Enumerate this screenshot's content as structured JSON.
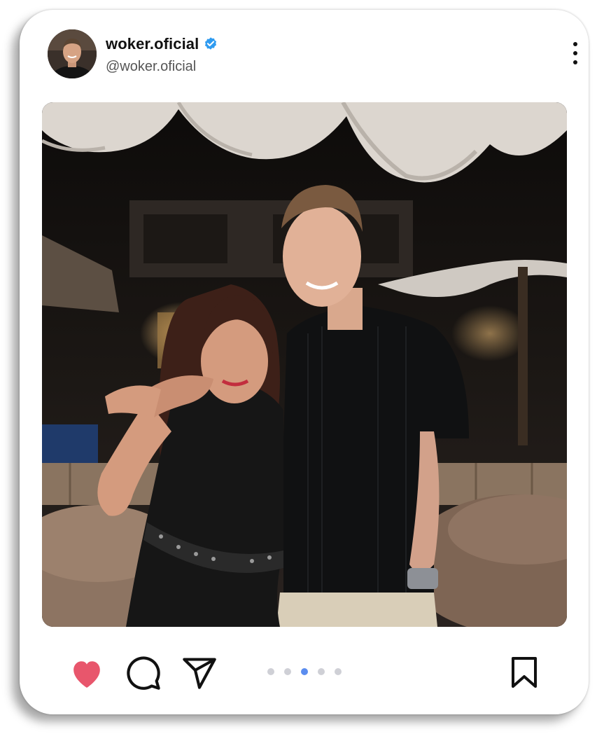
{
  "post": {
    "username": "woker.oficial",
    "handle": "@woker.oficial",
    "verified": true,
    "liked": true,
    "carousel": {
      "count": 5,
      "active_index": 2
    }
  },
  "icons": {
    "verified": "verified-badge-icon",
    "more": "more-vertical-icon",
    "like": "heart-icon",
    "comment": "comment-icon",
    "share": "send-icon",
    "save": "bookmark-icon"
  },
  "colors": {
    "like": "#e8566c",
    "verified": "#2f9bf0",
    "active_dot": "#5b8def",
    "inactive_dot": "#cfd0d6",
    "text": "#111111",
    "handle": "#555555"
  }
}
